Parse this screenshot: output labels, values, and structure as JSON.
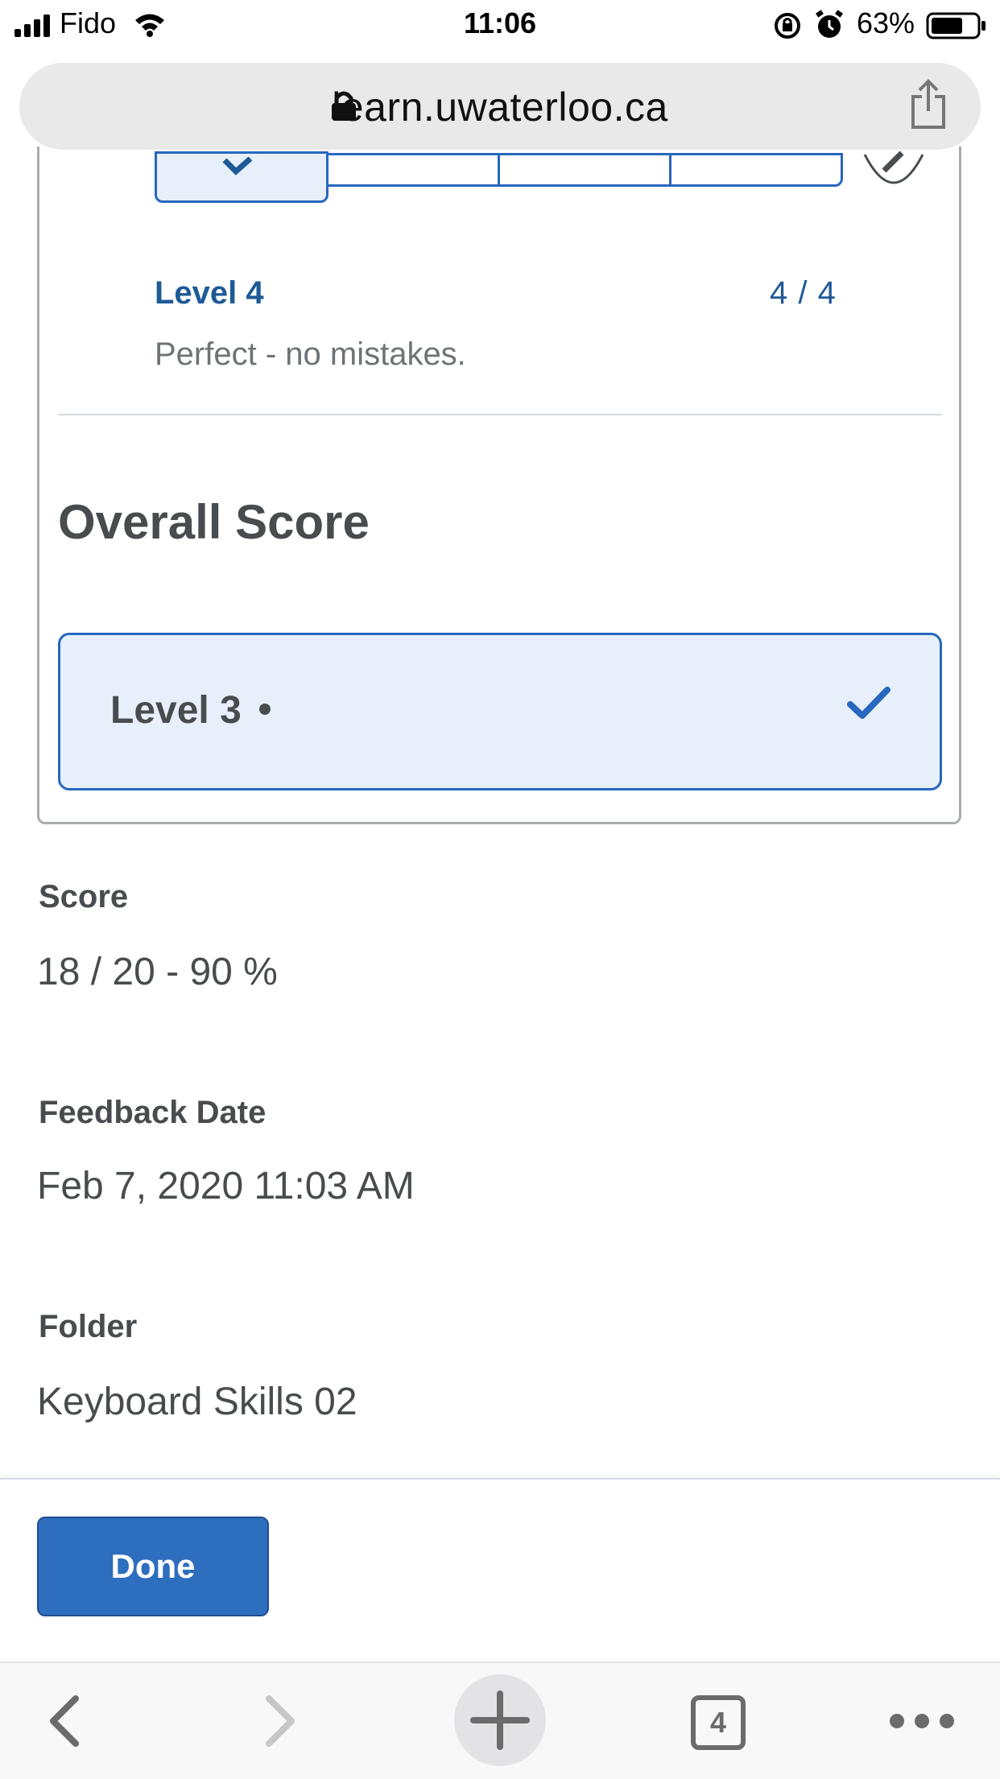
{
  "status_bar": {
    "carrier": "Fido",
    "time": "11:06",
    "battery": "63%"
  },
  "browser": {
    "url": "learn.uwaterloo.ca",
    "tab_count": "4"
  },
  "criterion": {
    "level": "Level 4",
    "score": "4 / 4",
    "description": "Perfect - no mistakes."
  },
  "overall": {
    "title": "Overall Score",
    "selected_level": "Level 3"
  },
  "details": {
    "score_label": "Score",
    "score_value": "18 / 20 - 90 %",
    "feedback_date_label": "Feedback Date",
    "feedback_date_value": "Feb 7, 2020 11:03 AM",
    "folder_label": "Folder",
    "folder_value": "Keyboard Skills 02"
  },
  "actions": {
    "done_label": "Done"
  },
  "colors": {
    "accent": "#2767bf",
    "selected_bg": "#e7f0fa",
    "text": "#494c4e"
  }
}
